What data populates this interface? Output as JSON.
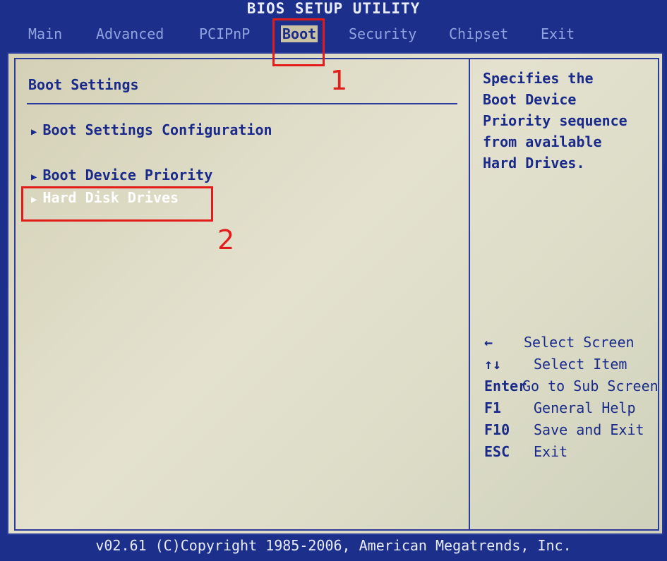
{
  "title": "BIOS SETUP UTILITY",
  "menu": {
    "tabs": [
      {
        "label": "Main"
      },
      {
        "label": "Advanced"
      },
      {
        "label": "PCIPnP"
      },
      {
        "label": "Boot"
      },
      {
        "label": "Security"
      },
      {
        "label": "Chipset"
      },
      {
        "label": "Exit"
      }
    ],
    "active": "Boot"
  },
  "main": {
    "section_title": "Boot Settings",
    "items": [
      {
        "label": "Boot Settings Configuration"
      },
      {
        "label": "Boot Device Priority"
      },
      {
        "label": "Hard Disk Drives"
      }
    ]
  },
  "help": {
    "lines": [
      "Specifies the",
      "Boot Device",
      "Priority sequence",
      "from available",
      "Hard Drives."
    ]
  },
  "keys": [
    {
      "key": "←",
      "desc": "Select Screen"
    },
    {
      "key": "↑↓",
      "desc": "Select Item"
    },
    {
      "key": "Enter",
      "desc": "Go to Sub Screen"
    },
    {
      "key": "F1",
      "desc": "General Help"
    },
    {
      "key": "F10",
      "desc": "Save and Exit"
    },
    {
      "key": "ESC",
      "desc": "Exit"
    }
  ],
  "footer": "v02.61 (C)Copyright 1985-2006, American Megatrends, Inc.",
  "annotations": {
    "label_1": "1",
    "label_2": "2",
    "color": "#e21b1b"
  }
}
